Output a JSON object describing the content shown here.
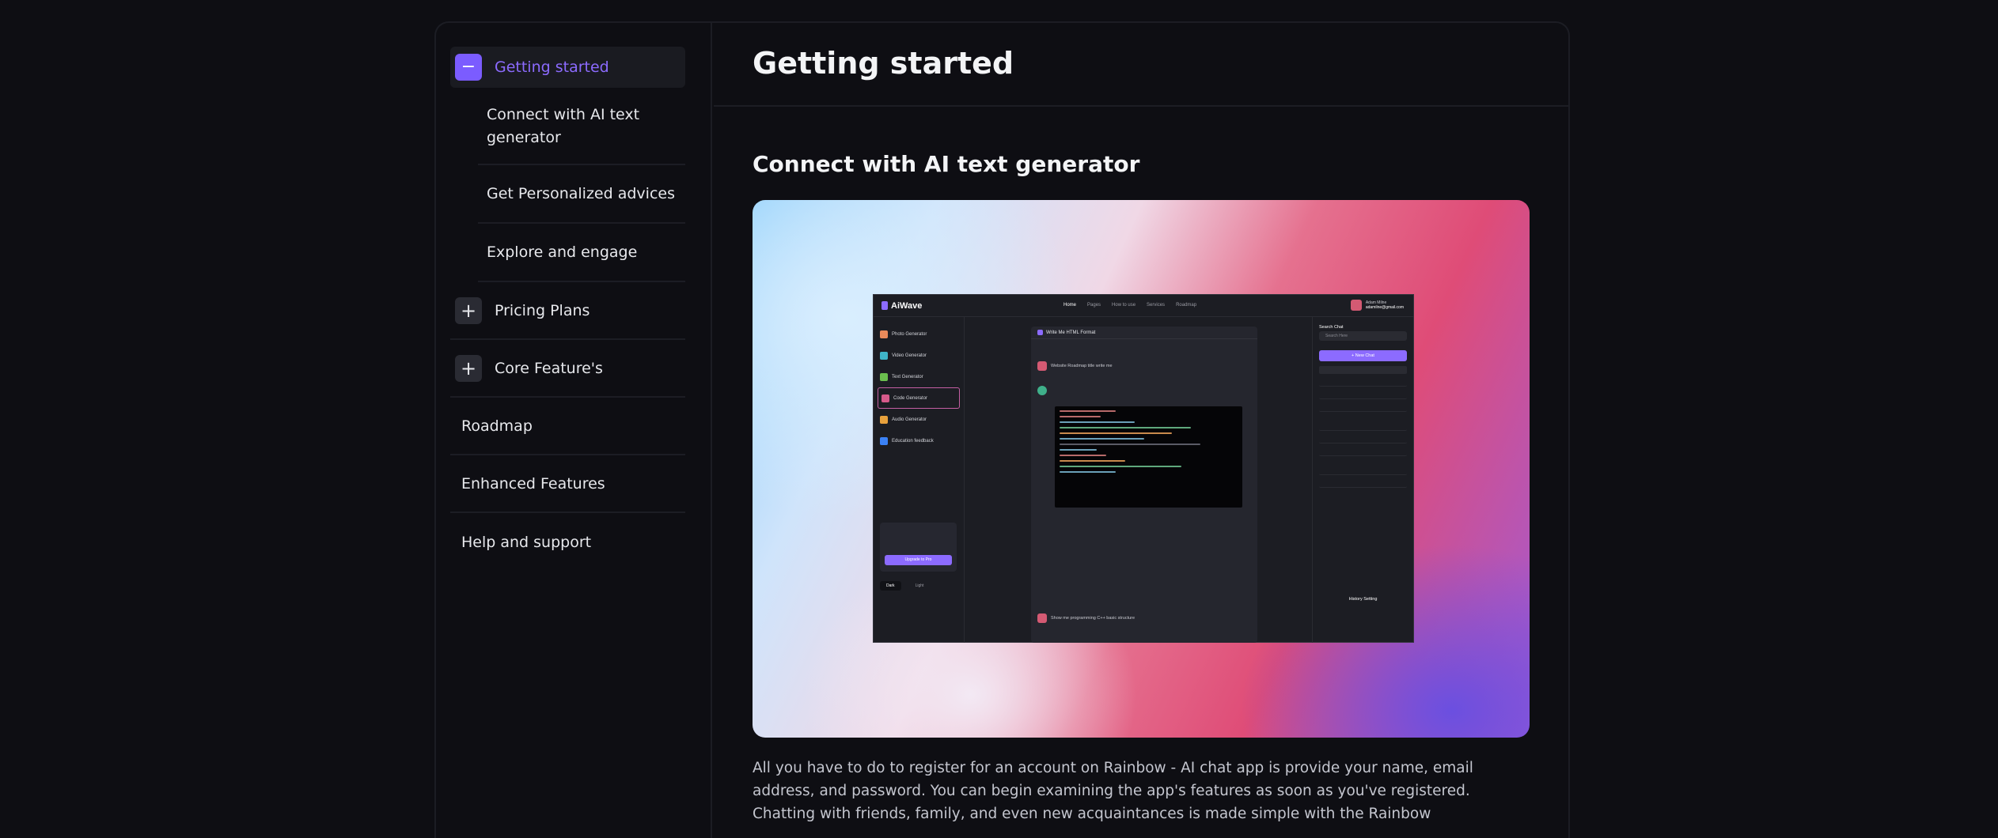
{
  "sidebar": {
    "items": [
      {
        "label": "Getting started",
        "toggle": "−",
        "active": true
      },
      {
        "label": "Pricing Plans",
        "toggle": "+"
      },
      {
        "label": "Core Feature's",
        "toggle": "+"
      },
      {
        "label": "Roadmap"
      },
      {
        "label": "Enhanced Features"
      },
      {
        "label": "Help and support"
      }
    ],
    "sub_items": [
      "Connect with AI text generator",
      "Get Personalized advices",
      "Explore and engage"
    ]
  },
  "main": {
    "title": "Getting started",
    "section_title": "Connect with AI text generator",
    "description": "All you have to do to register for an account on Rainbow - AI chat app is provide your name, email address, and password. You can begin examining the app's features as soon as you've registered. Chatting with friends, family, and even new acquaintances is made simple with the Rainbow"
  },
  "mock": {
    "logo": "AiWave",
    "nav": [
      "Home",
      "Pages",
      "How to use",
      "Services",
      "Roadmap"
    ],
    "user_name": "Adam Milne",
    "user_email": "adamilne@gmail.com",
    "side_items": [
      "Photo Generator",
      "Video Generator",
      "Text Generator",
      "Code Generator",
      "Audio Generator",
      "Education feedback"
    ],
    "chat_title": "Write Me HTML Format",
    "prompt_1": "Website Roadmap title write me",
    "prompt_2": "Show me programming C++ basic structure",
    "upgrade_label": "Upgrade to Pro",
    "dark_label": "Dark",
    "light_label": "Light",
    "search_title": "Search Chat",
    "search_placeholder": "Search Here",
    "new_chat": "+ New Chat",
    "history_setting": "History Setting"
  },
  "colors": {
    "accent": "#8c6bff",
    "background": "#0e0e13"
  }
}
